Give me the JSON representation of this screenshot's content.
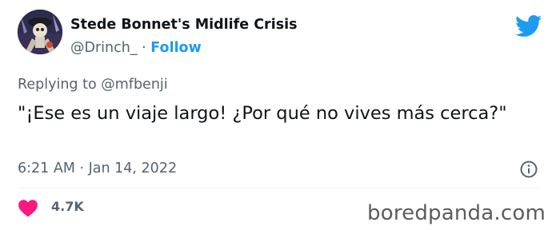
{
  "author": {
    "display_name": "Stede Bonnet's Midlife Crisis",
    "handle": "@Drinch_",
    "separator": " · ",
    "follow_label": "Follow"
  },
  "reply": {
    "prefix": "Replying to ",
    "mention": "@mfbenji"
  },
  "tweet": {
    "text": "\"¡Ese es un viaje largo! ¿Por qué no vives más cerca?\"",
    "timestamp": "6:21 AM · Jan 14, 2022"
  },
  "engagement": {
    "likes": "4.7K"
  },
  "watermark": "boredpanda.com",
  "colors": {
    "twitter_blue": "#1d9bf0",
    "heart_pink": "#f91880",
    "text_primary": "#0f1419",
    "text_secondary": "#536471"
  },
  "icons": [
    "twitter-bird-icon",
    "info-icon",
    "heart-icon"
  ]
}
